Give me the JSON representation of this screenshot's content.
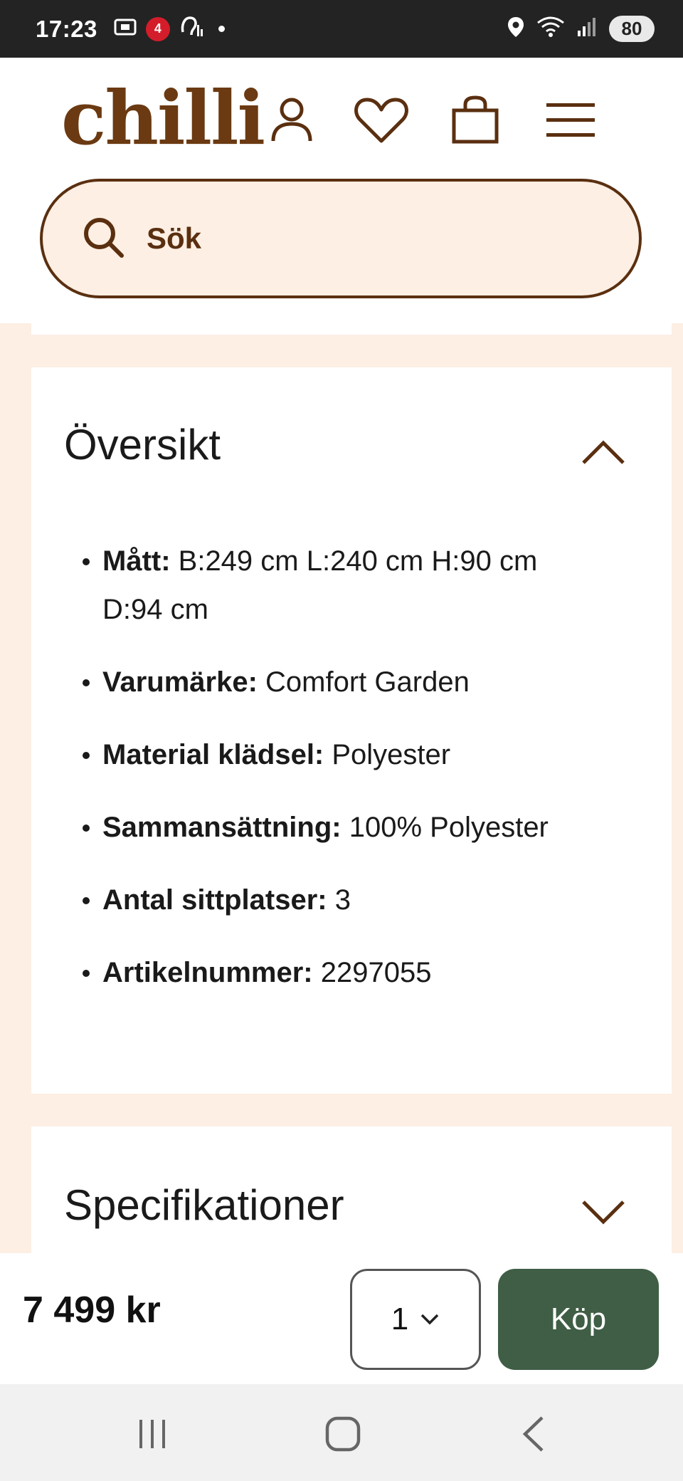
{
  "status_bar": {
    "time": "17:23",
    "badge": "4",
    "battery": "80",
    "icons": [
      "screenshot-icon",
      "hearing-icon",
      "location-icon",
      "wifi-icon",
      "signal-icon"
    ]
  },
  "header": {
    "logo": "chilli",
    "brand_color": "#6b3a12",
    "icons": [
      "account-icon",
      "heart-icon",
      "bag-icon",
      "menu-icon"
    ]
  },
  "search": {
    "placeholder": "Sök"
  },
  "overview": {
    "title": "Översikt",
    "expanded": true,
    "items": [
      {
        "key": "Mått:",
        "value": " B:249 cm L:240 cm H:90 cm D:94 cm"
      },
      {
        "key": "Varumärke:",
        "value": " Comfort Garden"
      },
      {
        "key": "Material klädsel:",
        "value": " Polyester"
      },
      {
        "key": "Sammansättning:",
        "value": " 100% Polyester"
      },
      {
        "key": "Antal sittplatser:",
        "value": " 3"
      },
      {
        "key": "Artikelnummer:",
        "value": " 2297055"
      }
    ]
  },
  "specifications": {
    "title": "Specifikationer",
    "expanded": false
  },
  "buy_bar": {
    "price": "7 499 kr",
    "quantity": "1",
    "buy_label": "Köp",
    "buy_color": "#3f5e45"
  },
  "nav": [
    "recents-icon",
    "home-icon",
    "back-icon"
  ]
}
